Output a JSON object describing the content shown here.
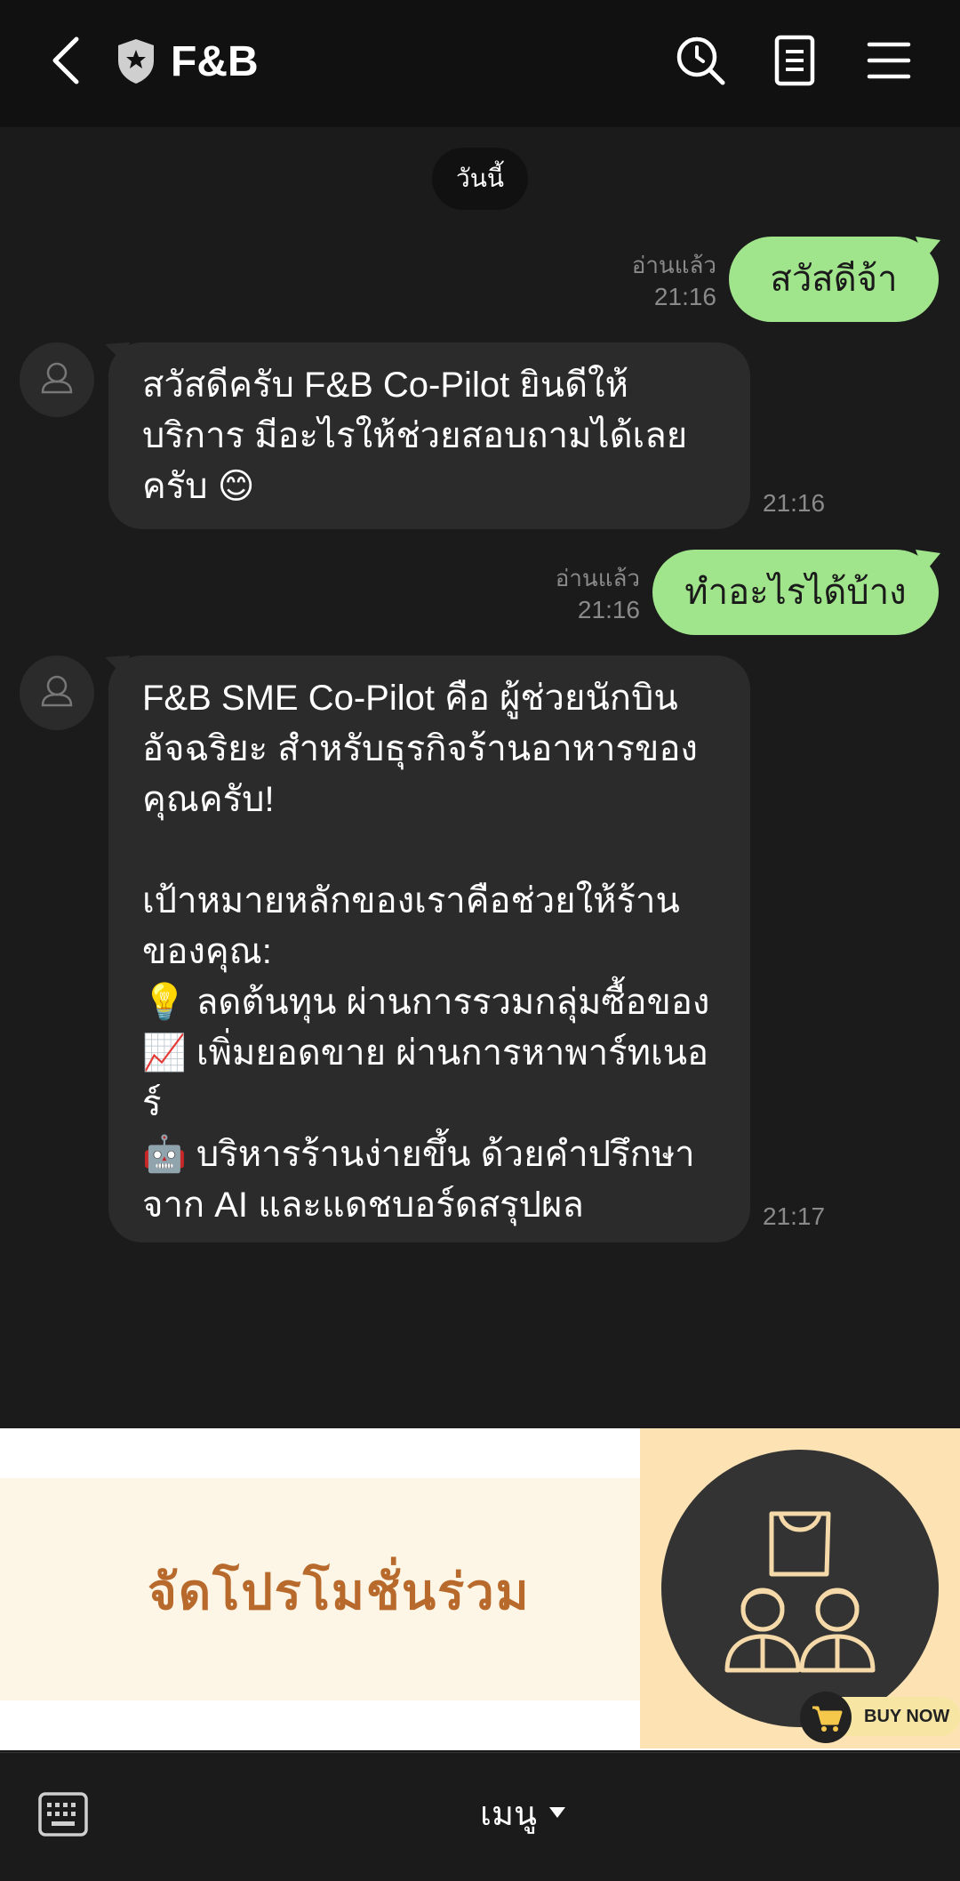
{
  "header": {
    "title": "F&B"
  },
  "date_separator": "วันนี้",
  "messages": [
    {
      "direction": "out",
      "text": "สวัสดีจ้า",
      "read": "อ่านแล้ว",
      "time": "21:16"
    },
    {
      "direction": "in",
      "lines": [
        "สวัสดีครับ F&B Co-Pilot ยินดีให้",
        "บริการ มีอะไรให้ช่วยสอบถามได้เลย",
        "ครับ 😊"
      ],
      "time": "21:16"
    },
    {
      "direction": "out",
      "text": "ทำอะไรได้บ้าง",
      "read": "อ่านแล้ว",
      "time": "21:16"
    },
    {
      "direction": "in",
      "lines": [
        "F&B SME Co-Pilot คือ ผู้ช่วยนักบิน",
        "อัจฉริยะ สำหรับธุรกิจร้านอาหารของ",
        "คุณครับ!",
        "",
        "เป้าหมายหลักของเราคือช่วยให้ร้าน",
        "ของคุณ:",
        "💡 ลดต้นทุน ผ่านการรวมกลุ่มซื้อของ",
        "📈 เพิ่มยอดขาย ผ่านการหาพาร์ทเนอ",
        "ร์",
        "🤖 บริหารร้านง่ายขึ้น ด้วยคำปรึกษา",
        "จาก AI และแดชบอร์ดสรุปผล"
      ],
      "time": "21:17"
    }
  ],
  "banner": {
    "text": "จัดโปรโมชั่นร่วม",
    "buy_now": "BUY NOW"
  },
  "bottom": {
    "menu_label": "เมนู"
  },
  "colors": {
    "outgoing_bubble": "#a0e48c",
    "incoming_bubble": "#2b2b2b",
    "background": "#1b1b1b",
    "banner_text": "#b86a2c"
  }
}
